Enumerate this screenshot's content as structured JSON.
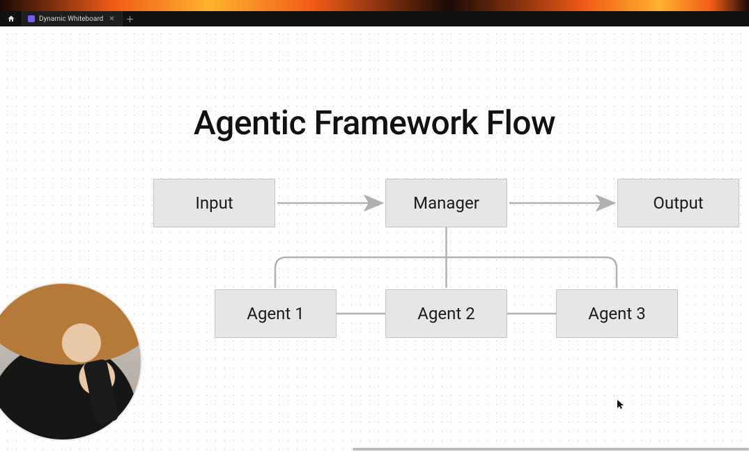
{
  "tab": {
    "title": "Dynamic Whiteboard"
  },
  "diagram": {
    "title": "Agentic Framework Flow",
    "nodes": {
      "input": "Input",
      "manager": "Manager",
      "output": "Output",
      "agent1": "Agent 1",
      "agent2": "Agent 2",
      "agent3": "Agent 3"
    }
  }
}
